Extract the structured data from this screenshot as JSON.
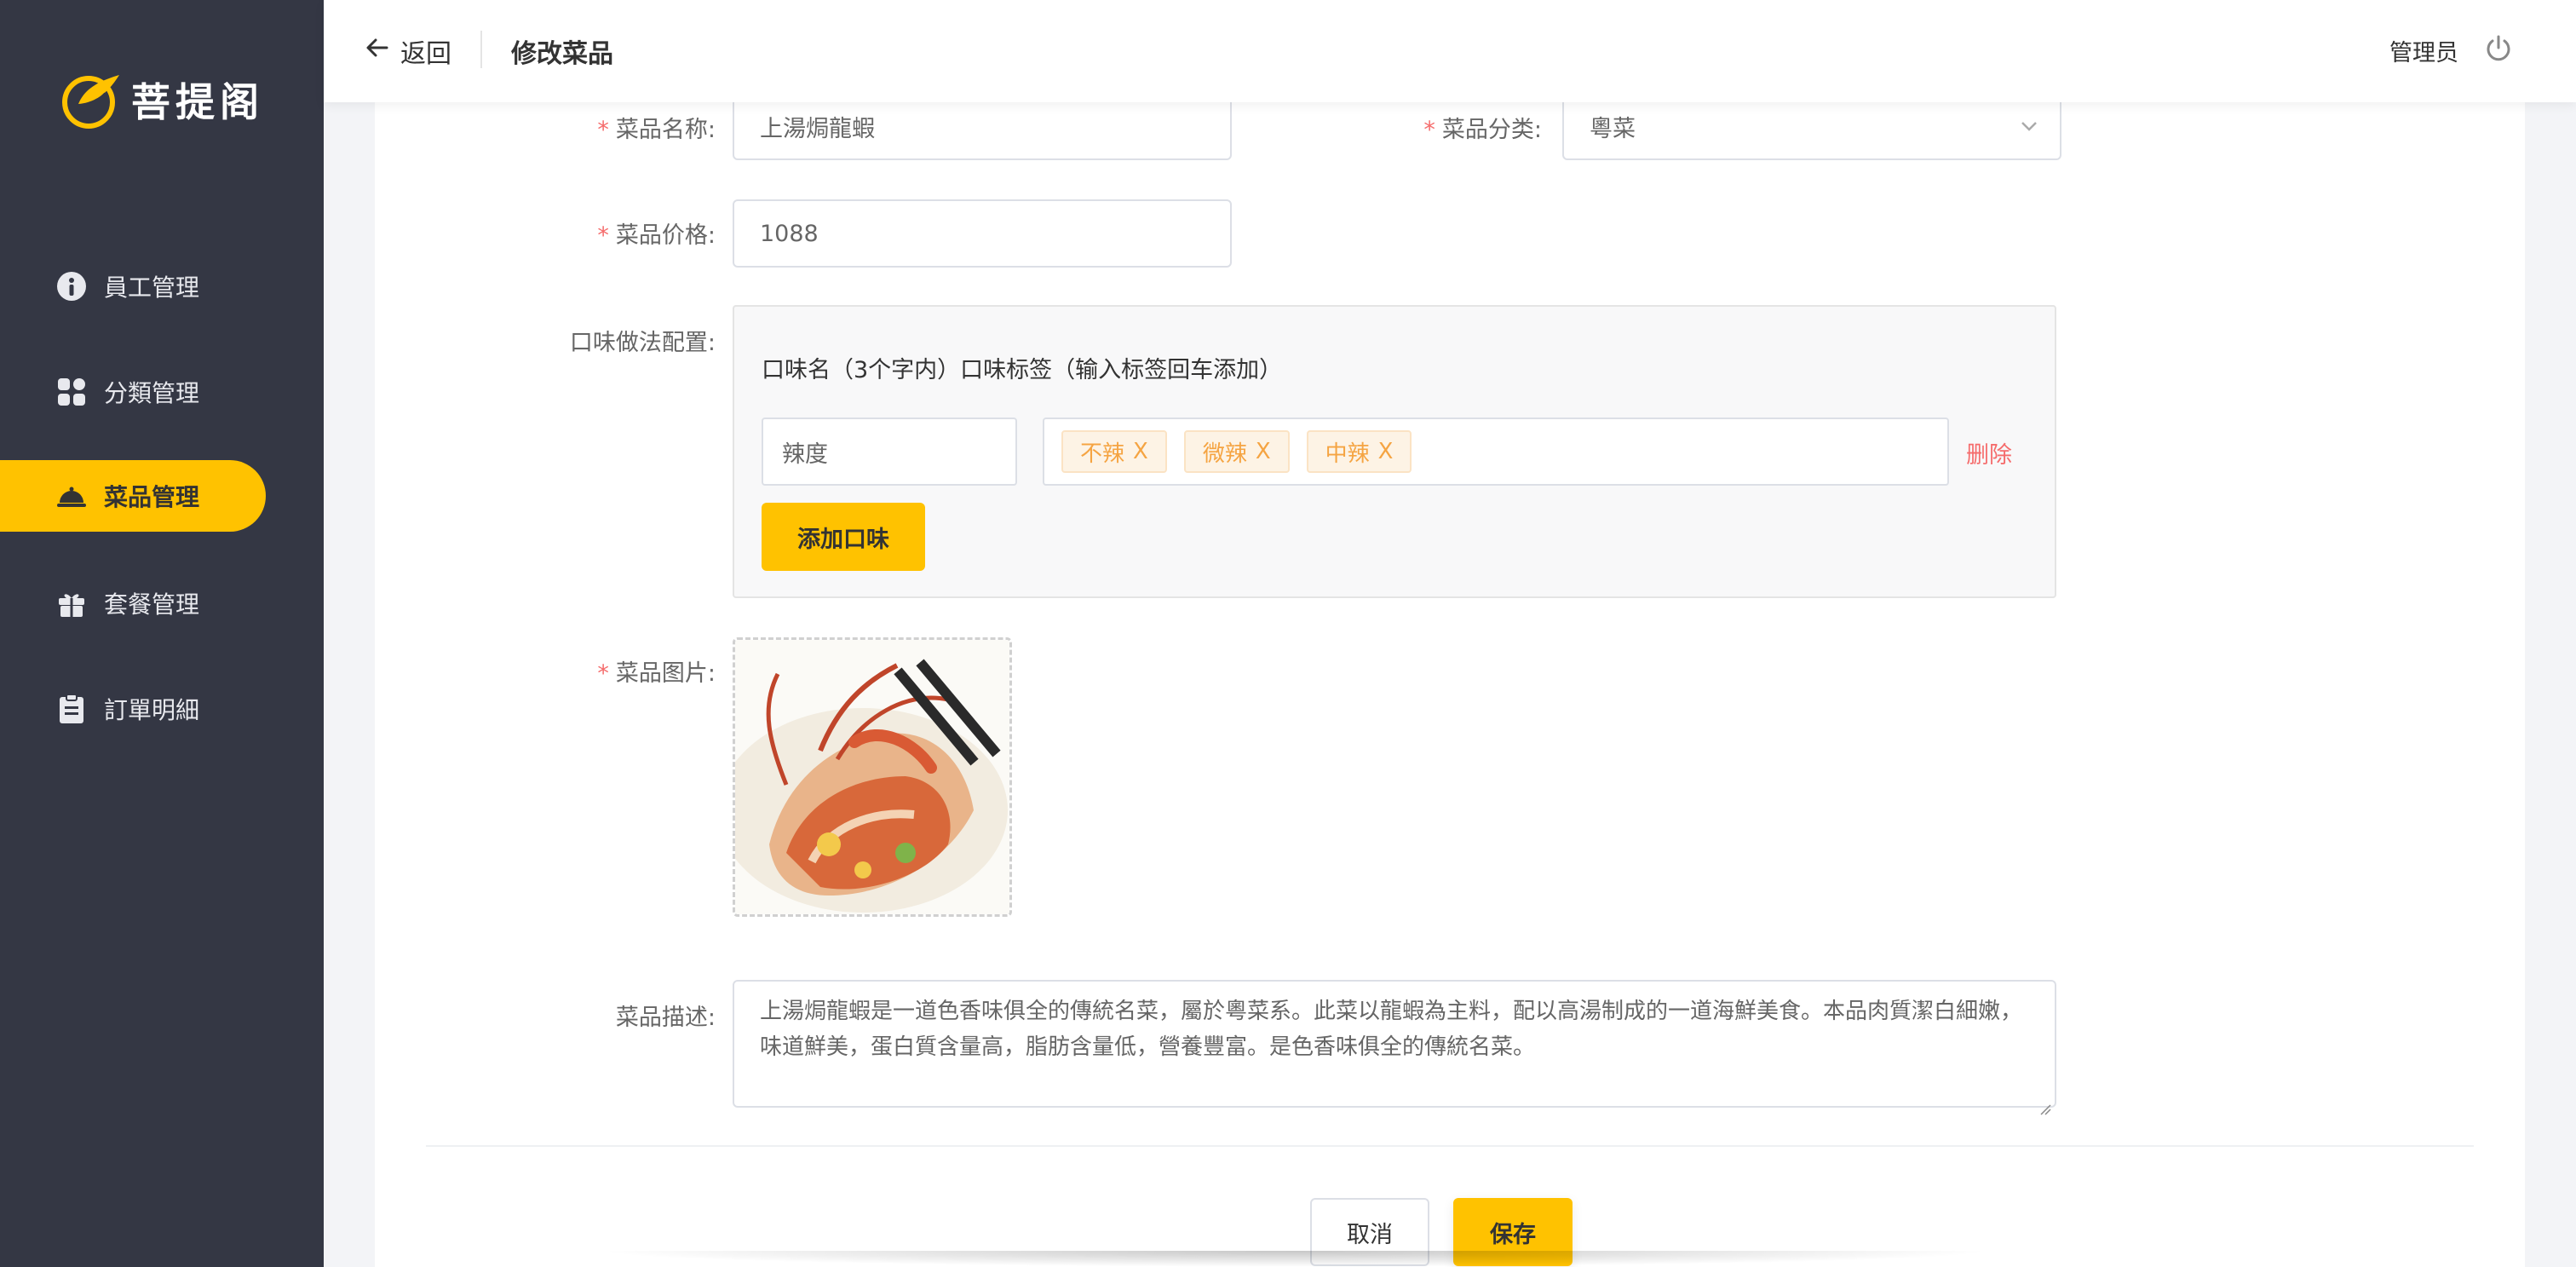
{
  "brand": {
    "name": "菩提阁"
  },
  "sidebar": {
    "items": [
      {
        "label": "員工管理",
        "icon": "employee-icon",
        "active": false
      },
      {
        "label": "分類管理",
        "icon": "category-icon",
        "active": false
      },
      {
        "label": "菜品管理",
        "icon": "dish-cloche-icon",
        "active": true
      },
      {
        "label": "套餐管理",
        "icon": "gift-icon",
        "active": false
      },
      {
        "label": "訂單明細",
        "icon": "clipboard-icon",
        "active": false
      }
    ]
  },
  "header": {
    "back_label": "返回",
    "title": "修改菜品",
    "user": "管理员"
  },
  "form": {
    "name_label": "菜品名称:",
    "name_value": "上湯焗龍蝦",
    "category_label": "菜品分类:",
    "category_value": "粵菜",
    "price_label": "菜品价格:",
    "price_value": "1088",
    "flavor_label": "口味做法配置:",
    "flavor_head": "口味名（3个字内）口味标签（输入标签回车添加）",
    "flavor_name": "辣度",
    "flavor_tags": [
      "不辣",
      "微辣",
      "中辣"
    ],
    "tag_remove": "X",
    "delete_label": "删除",
    "add_flavor_label": "添加口味",
    "image_label": "菜品图片:",
    "desc_label": "菜品描述:",
    "desc_value": "上湯焗龍蝦是一道色香味俱全的傳統名菜，屬於粵菜系。此菜以龍蝦為主料，配以高湯制成的一道海鮮美食。本品肉質潔白細嫩，味道鮮美，蛋白質含量高，脂肪含量低，營養豐富。是色香味俱全的傳統名菜。",
    "required_mark": "*"
  },
  "actions": {
    "cancel": "取消",
    "save": "保存"
  },
  "colors": {
    "accent": "#ffc200",
    "sidebar_bg": "#343744",
    "danger": "#f56c6c",
    "tag_text": "#f5a442"
  }
}
